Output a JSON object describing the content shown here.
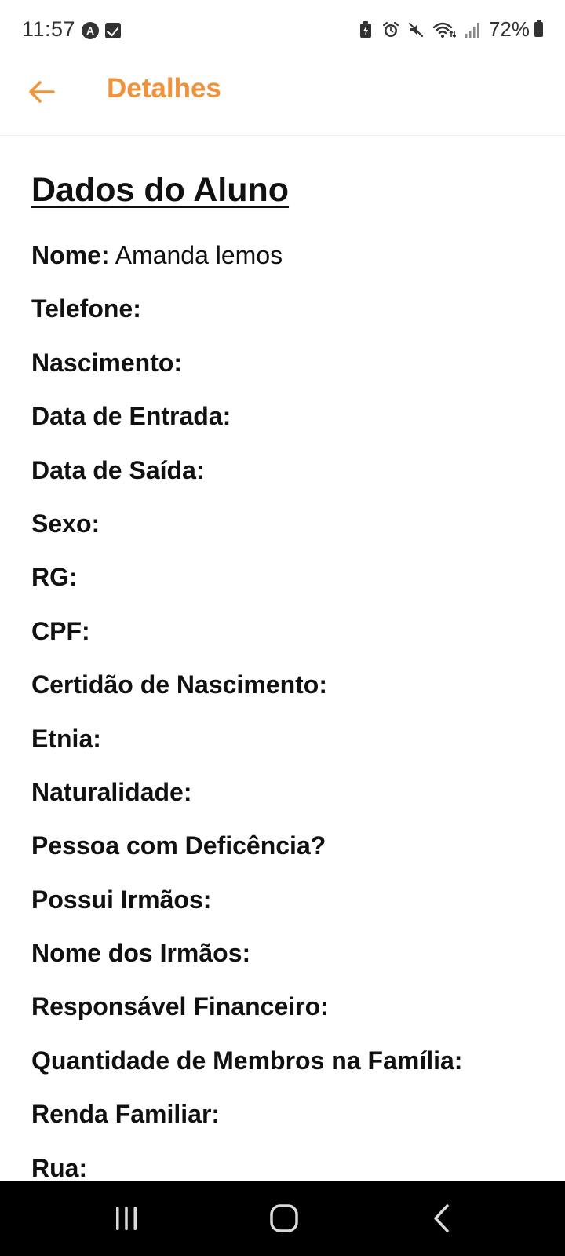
{
  "status_bar": {
    "time": "11:57",
    "left_icons": [
      "app-a-icon",
      "checkbox-notification-icon"
    ],
    "a_letter": "A",
    "right_icons": [
      "battery-saver-icon",
      "alarm-icon",
      "mute-icon",
      "wifi-icon",
      "signal-icon"
    ],
    "battery": "72%"
  },
  "header": {
    "back_icon": "arrow-left-icon",
    "title": "Detalhes",
    "accent_color": "#f0923a"
  },
  "section": {
    "title": "Dados do Aluno"
  },
  "fields": [
    {
      "label": "Nome:",
      "value": " Amanda lemos"
    },
    {
      "label": "Telefone:",
      "value": ""
    },
    {
      "label": "Nascimento:",
      "value": ""
    },
    {
      "label": "Data de Entrada:",
      "value": ""
    },
    {
      "label": "Data de Saída:",
      "value": ""
    },
    {
      "label": "Sexo:",
      "value": ""
    },
    {
      "label": "RG:",
      "value": ""
    },
    {
      "label": "CPF:",
      "value": ""
    },
    {
      "label": "Certidão de Nascimento:",
      "value": ""
    },
    {
      "label": "Etnia:",
      "value": ""
    },
    {
      "label": "Naturalidade:",
      "value": ""
    },
    {
      "label": "Pessoa com Deficência?",
      "value": ""
    },
    {
      "label": "Possui Irmãos:",
      "value": ""
    },
    {
      "label": "Nome dos Irmãos:",
      "value": ""
    },
    {
      "label": "Responsável Financeiro:",
      "value": ""
    },
    {
      "label": "Quantidade de Membros na Família:",
      "value": ""
    },
    {
      "label": "Renda Familiar:",
      "value": ""
    },
    {
      "label": "Rua:",
      "value": ""
    }
  ],
  "nav_bar": {
    "buttons": [
      "recent-apps-icon",
      "home-icon",
      "back-icon"
    ]
  }
}
